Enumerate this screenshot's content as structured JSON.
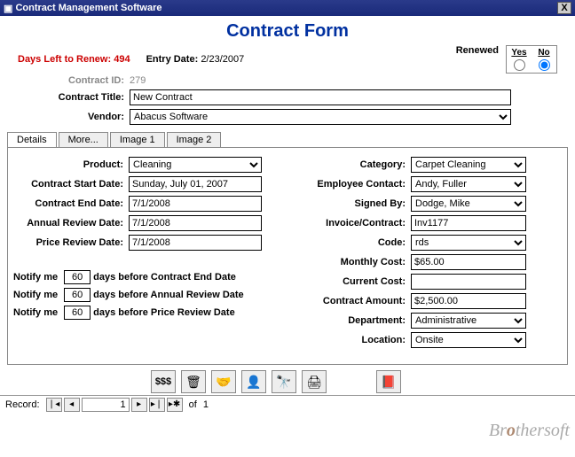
{
  "window": {
    "title": "Contract Management Software",
    "close": "X"
  },
  "header": {
    "formTitle": "Contract Form",
    "daysLeftLabel": "Days Left to Renew:",
    "daysLeftValue": "494",
    "entryDateLabel": "Entry Date:",
    "entryDateValue": "2/23/2007",
    "renewedLabel": "Renewed",
    "yes": "Yes",
    "no": "No"
  },
  "idrow": {
    "label": "Contract ID:",
    "value": "279"
  },
  "contractTitle": {
    "label": "Contract Title:",
    "value": "New Contract"
  },
  "vendor": {
    "label": "Vendor:",
    "value": "Abacus Software"
  },
  "tabs": {
    "details": "Details",
    "more": "More...",
    "image1": "Image 1",
    "image2": "Image 2"
  },
  "left": {
    "product": {
      "label": "Product:",
      "value": "Cleaning"
    },
    "start": {
      "label": "Contract Start Date:",
      "value": "Sunday, July 01, 2007"
    },
    "end": {
      "label": "Contract End Date:",
      "value": "7/1/2008"
    },
    "annual": {
      "label": "Annual Review Date:",
      "value": "7/1/2008"
    },
    "price": {
      "label": "Price Review Date:",
      "value": "7/1/2008"
    }
  },
  "right": {
    "category": {
      "label": "Category:",
      "value": "Carpet Cleaning"
    },
    "empContact": {
      "label": "Employee Contact:",
      "value": "Andy, Fuller"
    },
    "signedBy": {
      "label": "Signed By:",
      "value": "Dodge, Mike"
    },
    "invoice": {
      "label": "Invoice/Contract:",
      "value": "Inv1177"
    },
    "code": {
      "label": "Code:",
      "value": "rds"
    },
    "monthly": {
      "label": "Monthly Cost:",
      "value": "$65.00"
    },
    "current": {
      "label": "Current Cost:",
      "value": ""
    },
    "amount": {
      "label": "Contract Amount:",
      "value": "$2,500.00"
    },
    "dept": {
      "label": "Department:",
      "value": "Administrative"
    },
    "loc": {
      "label": "Location:",
      "value": "Onsite"
    }
  },
  "notify": {
    "label": "Notify me",
    "val": "60",
    "end": "days before Contract End Date",
    "annual": "days before Annual Review Date",
    "price": "days before Price Review Date"
  },
  "toolbar": {
    "money": "$$$"
  },
  "record": {
    "label": "Record:",
    "cur": "1",
    "of": "of",
    "total": "1"
  },
  "watermark": {
    "a": "Br",
    "b": "o",
    "c": "thersoft"
  }
}
